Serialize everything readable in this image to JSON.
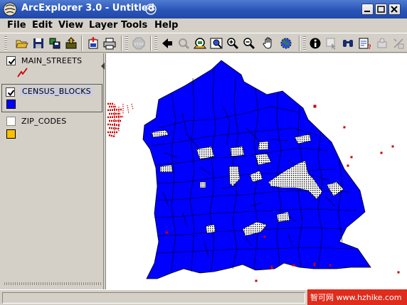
{
  "window": {
    "title": "ArcExplorer 3.0 - Untitled",
    "app_icon": "arcexplorer-globe-icon"
  },
  "menu": {
    "items": [
      "File",
      "Edit",
      "View",
      "Layer",
      "Tools",
      "Help"
    ]
  },
  "toolbar": {
    "icons": [
      "open-icon",
      "save-icon",
      "print-setup-icon",
      "export-icon",
      "add-layer-icon",
      "print-icon",
      "stop-icon",
      "zoom-previous-icon",
      "zoom-next-icon",
      "full-extent-icon",
      "zoom-active-layer-icon",
      "zoom-in-icon",
      "zoom-out-icon",
      "pan-icon",
      "globe-icon",
      "identify-icon",
      "select-icon",
      "find-icon",
      "query-icon",
      "measure-icon",
      "hotlink-icon"
    ]
  },
  "layers": [
    {
      "name": "MAIN_STREETS",
      "checked": true,
      "symbol": "line",
      "color": "#cc0000"
    },
    {
      "name": "CENSUS_BLOCKS",
      "checked": true,
      "symbol": "fill",
      "color": "#0000ff",
      "active": true
    },
    {
      "name": "ZIP_CODES",
      "checked": false,
      "symbol": "fill",
      "color": "#ffc000"
    }
  ],
  "map": {
    "polygon_fill": "#0000ff",
    "outline": "#000000",
    "highlight_color": "#cc0000"
  },
  "watermark": {
    "text": "智可网 www.hzhike.com"
  }
}
